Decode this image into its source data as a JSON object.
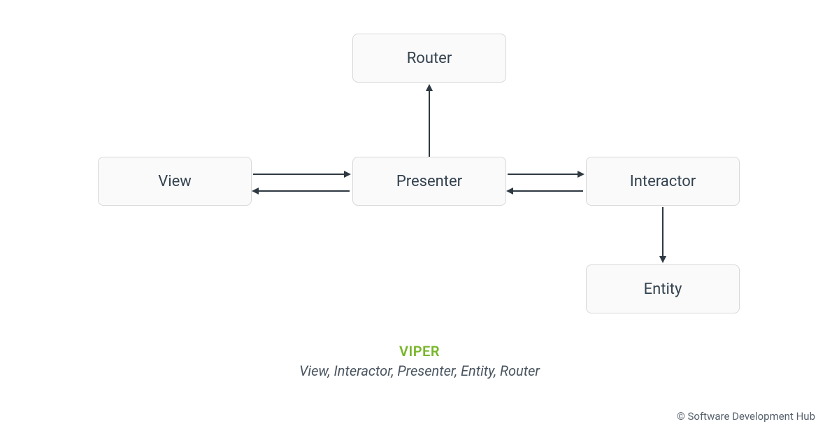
{
  "nodes": {
    "router": "Router",
    "view": "View",
    "presenter": "Presenter",
    "interactor": "Interactor",
    "entity": "Entity"
  },
  "caption": {
    "title": "VIPER",
    "subtitle": "View, Interactor, Presenter, Entity, Router"
  },
  "footer": {
    "copyright": "© Software Development Hub"
  },
  "diagram": {
    "edges": [
      {
        "from": "presenter",
        "to": "router",
        "direction": "up",
        "bidirectional": false
      },
      {
        "from": "view",
        "to": "presenter",
        "direction": "right",
        "bidirectional": true
      },
      {
        "from": "presenter",
        "to": "interactor",
        "direction": "right",
        "bidirectional": true
      },
      {
        "from": "interactor",
        "to": "entity",
        "direction": "down",
        "bidirectional": false
      }
    ]
  },
  "colors": {
    "node_bg": "#fafafa",
    "node_border": "#d8d8d8",
    "text": "#33424f",
    "accent_green": "#77b62a",
    "arrow": "#2e3942"
  }
}
